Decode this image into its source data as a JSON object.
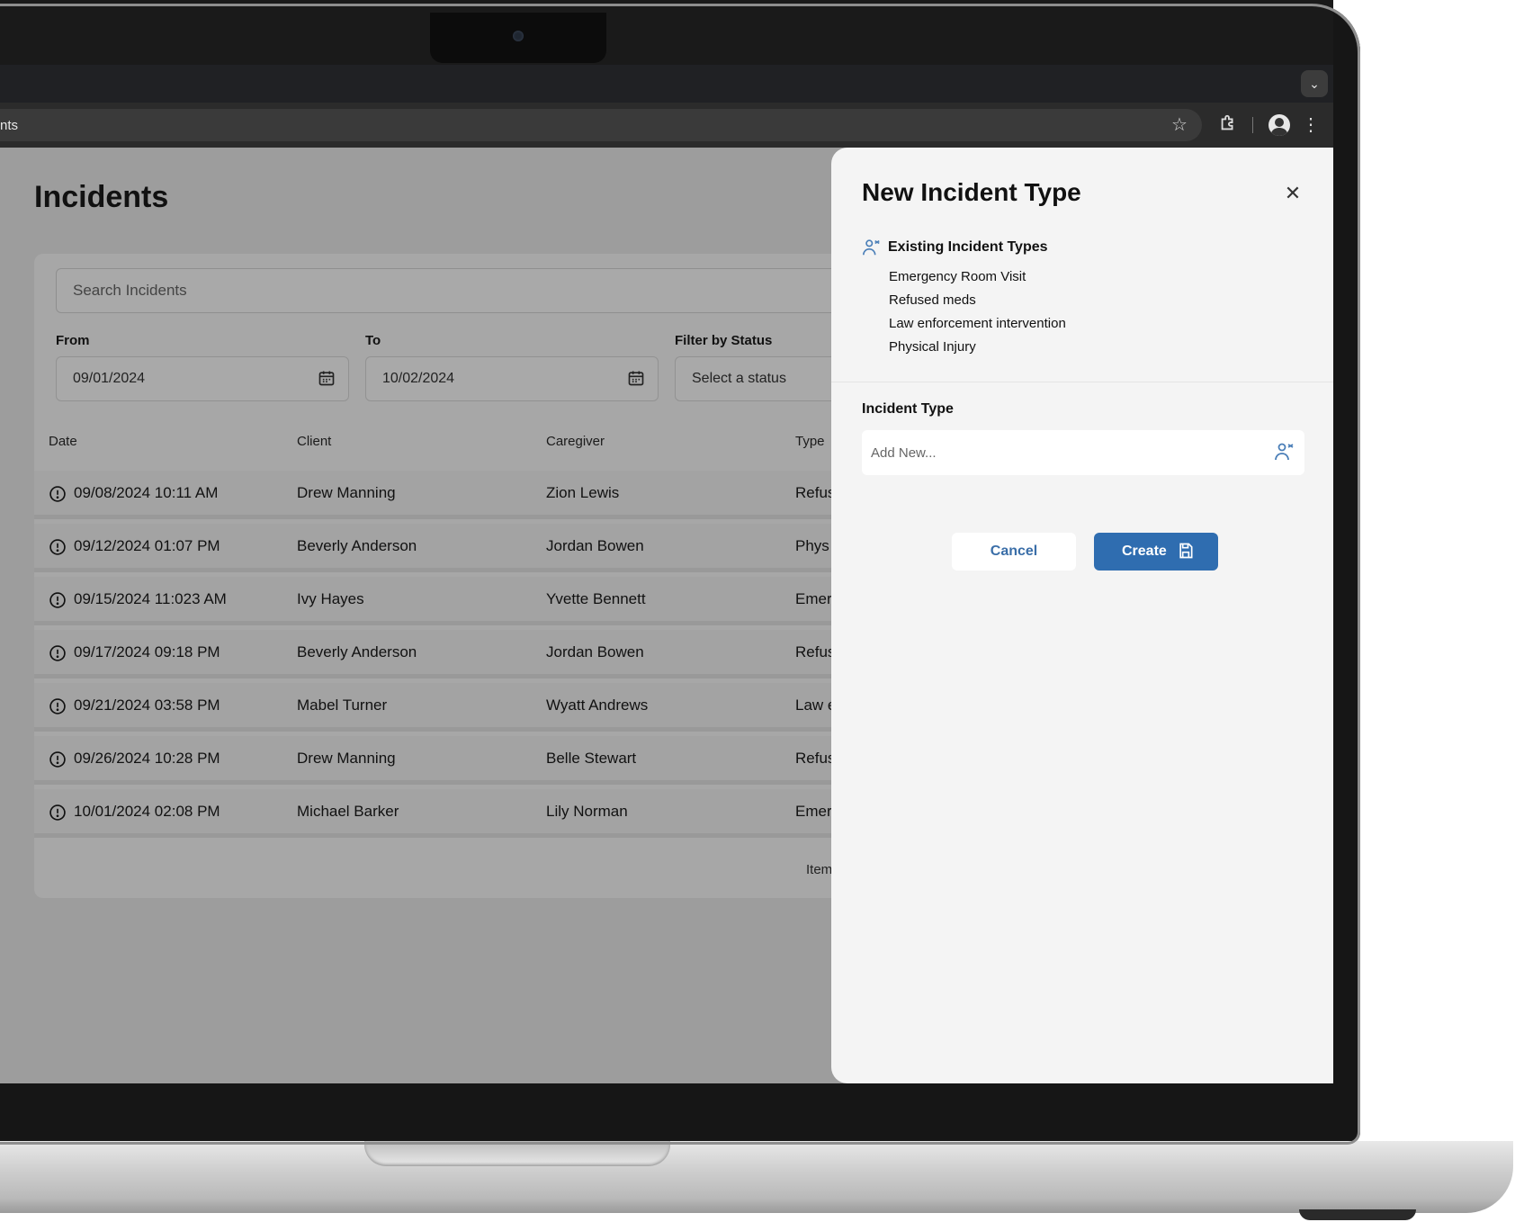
{
  "browser": {
    "url_fragment": "nts",
    "icons": [
      "bookmark-star-icon",
      "extensions-icon",
      "profile-avatar-icon",
      "more-vert-icon",
      "tab-search-chevron-icon"
    ]
  },
  "page": {
    "title": "Incidents",
    "search_placeholder": "Search Incidents",
    "filters": {
      "from_label": "From",
      "from_value": "09/01/2024",
      "to_label": "To",
      "to_value": "10/02/2024",
      "status_label": "Filter by Status",
      "status_placeholder": "Select a status"
    },
    "table": {
      "columns": [
        "Date",
        "Client",
        "Caregiver",
        "Type"
      ],
      "rows": [
        {
          "date": "09/08/2024 10:11 AM",
          "client": "Drew Manning",
          "caregiver": "Zion Lewis",
          "type": "Refus"
        },
        {
          "date": "09/12/2024 01:07 PM",
          "client": "Beverly Anderson",
          "caregiver": "Jordan Bowen",
          "type": "Phys"
        },
        {
          "date": "09/15/2024 11:023 AM",
          "client": "Ivy Hayes",
          "caregiver": "Yvette Bennett",
          "type": "Emer"
        },
        {
          "date": "09/17/2024 09:18 PM",
          "client": "Beverly Anderson",
          "caregiver": "Jordan Bowen",
          "type": "Refus"
        },
        {
          "date": "09/21/2024 03:58 PM",
          "client": "Mabel Turner",
          "caregiver": "Wyatt Andrews",
          "type": "Law e"
        },
        {
          "date": "09/26/2024 10:28 PM",
          "client": "Drew Manning",
          "caregiver": "Belle Stewart",
          "type": "Refus"
        },
        {
          "date": "10/01/2024 02:08 PM",
          "client": "Michael Barker",
          "caregiver": "Lily Norman",
          "type": "Emer"
        }
      ],
      "footer_text": "Item"
    }
  },
  "panel": {
    "title": "New Incident Type",
    "close_glyph": "✕",
    "existing_title": "Existing Incident Types",
    "existing_items": [
      "Emergency Room Visit",
      "Refused meds",
      "Law enforcement intervention",
      "Physical Injury"
    ],
    "field_label": "Incident Type",
    "field_placeholder": "Add New...",
    "cancel_label": "Cancel",
    "create_label": "Create"
  },
  "colors": {
    "primary": "#2f6db0",
    "overlay": "#9d9d9d",
    "panel_bg": "#f4f4f4"
  }
}
